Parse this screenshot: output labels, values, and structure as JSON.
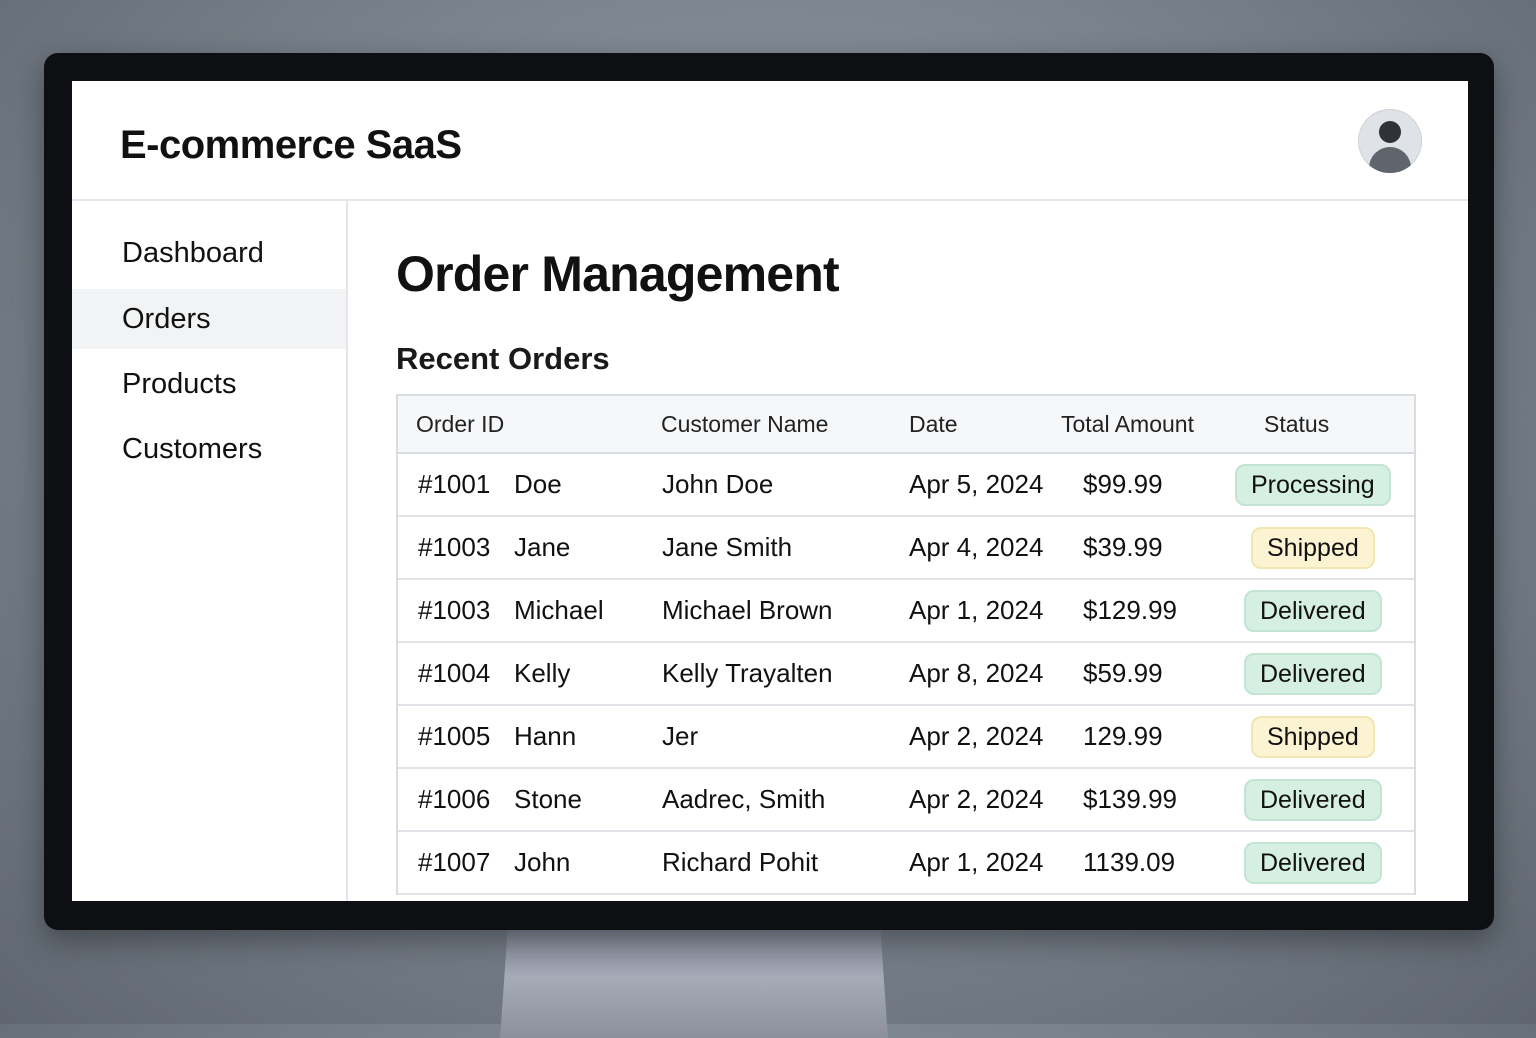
{
  "app": {
    "title": "E-commerce SaaS"
  },
  "sidebar": {
    "items": [
      {
        "label": "Dashboard",
        "active": false
      },
      {
        "label": "Orders",
        "active": true
      },
      {
        "label": "Products",
        "active": false
      },
      {
        "label": "Customers",
        "active": false
      }
    ]
  },
  "main": {
    "page_title": "Order Management",
    "section_title": "Recent Orders",
    "table": {
      "headers": [
        "Order ID",
        "Customer Name",
        "Date",
        "Total Amount",
        "Status"
      ],
      "rows": [
        {
          "id": "#1001",
          "short": "Doe",
          "customer": "John Doe",
          "date": "Apr 5, 2024",
          "amount": "$99.99",
          "status": "Processing",
          "status_type": "processing"
        },
        {
          "id": "#1003",
          "short": "Jane",
          "customer": "Jane Smith",
          "date": "Apr 4, 2024",
          "amount": "$39.99",
          "status": "Shipped",
          "status_type": "shipped"
        },
        {
          "id": "#1003",
          "short": "Michael",
          "customer": "Michael Brown",
          "date": "Apr 1, 2024",
          "amount": "$129.99",
          "status": "Delivered",
          "status_type": "delivered"
        },
        {
          "id": "#1004",
          "short": "Kelly",
          "customer": "Kelly Trayalten",
          "date": "Apr 8, 2024",
          "amount": "$59.99",
          "status": "Delivered",
          "status_type": "delivered"
        },
        {
          "id": "#1005",
          "short": "Hann",
          "customer": "Jer",
          "date": "Apr 2, 2024",
          "amount": "129.99",
          "status": "Shipped",
          "status_type": "shipped"
        },
        {
          "id": "#1006",
          "short": "Stone",
          "customer": "Aadrec, Smith",
          "date": "Apr 2, 2024",
          "amount": "$139.99",
          "status": "Delivered",
          "status_type": "delivered"
        },
        {
          "id": "#1007",
          "short": "John",
          "customer": "Richard Pohit",
          "date": "Apr 1, 2024",
          "amount": "1139.09",
          "status": "Delivered",
          "status_type": "delivered"
        }
      ]
    }
  },
  "icons": {
    "avatar": "user-avatar-icon"
  },
  "colors": {
    "status_processing_bg": "#d6efe3",
    "status_delivered_bg": "#d6efe3",
    "status_shipped_bg": "#fbf3d2",
    "nav_active_bg": "#f2f3f5"
  }
}
